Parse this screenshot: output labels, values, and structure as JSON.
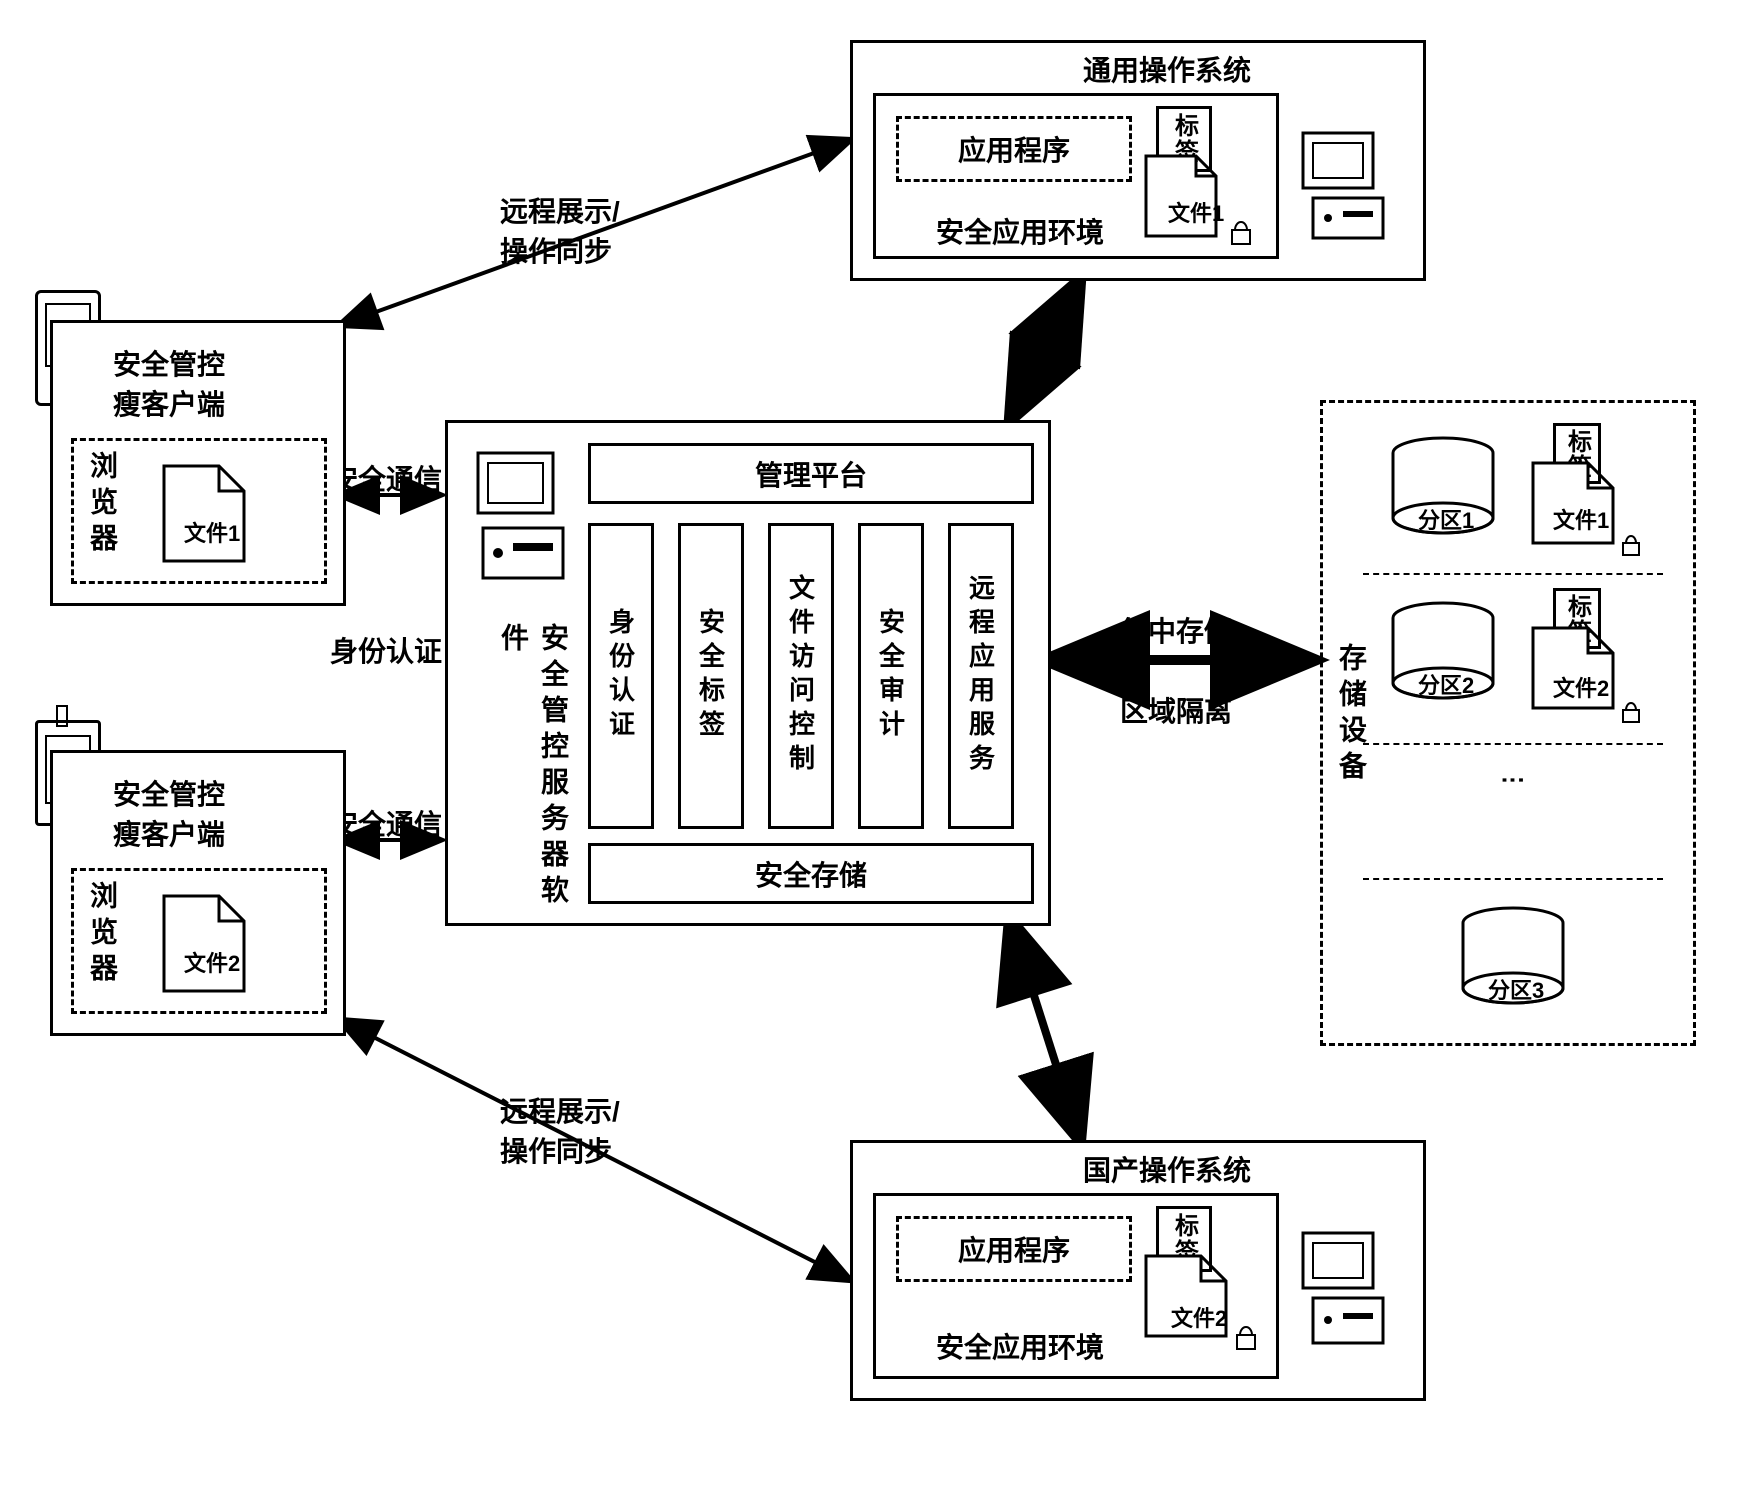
{
  "topSystem": {
    "title": "通用操作系统",
    "app": "应用程序",
    "env": "安全应用环境",
    "file": "文件1",
    "tag": "标签"
  },
  "bottomSystem": {
    "title": "国产操作系统",
    "app": "应用程序",
    "env": "安全应用环境",
    "file": "文件2",
    "tag": "标签"
  },
  "client1": {
    "title1": "安全管控",
    "title2": "瘦客户端",
    "browser": "浏览器",
    "file": "文件1"
  },
  "client2": {
    "title1": "安全管控",
    "title2": "瘦客户端",
    "browser": "浏览器",
    "file": "文件2"
  },
  "server": {
    "software": "安全管控服务器软件",
    "platform": "管理平台",
    "pillars": [
      "身份认证",
      "安全标签",
      "文件访问控制",
      "安全审计",
      "远程应用服务"
    ],
    "storage": "安全存储"
  },
  "storage": {
    "title": "存储设备",
    "p1": "分区1",
    "p2": "分区2",
    "p3": "分区3",
    "f1": "文件1",
    "f2": "文件2",
    "tag": "标签"
  },
  "arrows": {
    "remoteSync": "远程展示/\n操作同步",
    "secureComm": "安全通信",
    "idAuth": "身份认证",
    "centralStore": "集中存储",
    "zoneIsolate": "区域隔离"
  }
}
